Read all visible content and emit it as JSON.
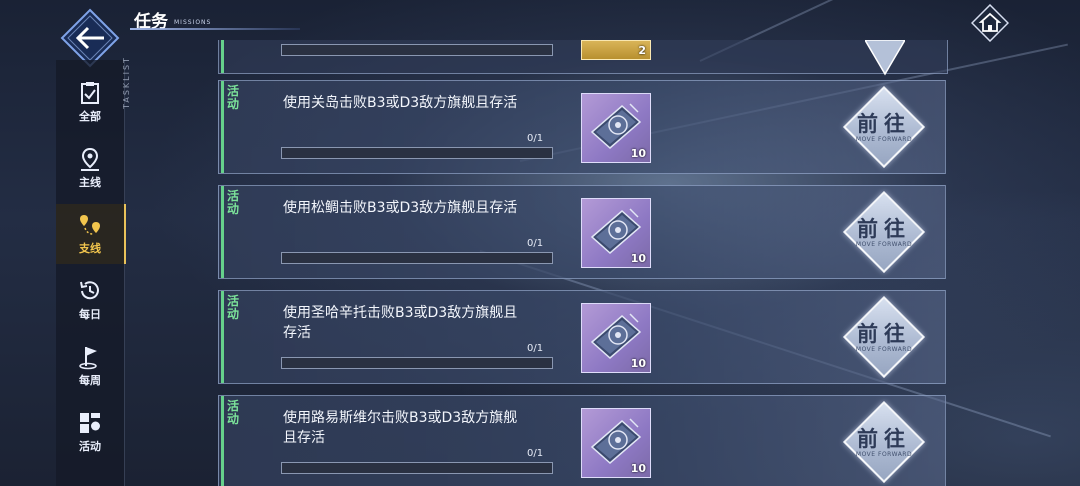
{
  "header": {
    "title": "任务",
    "subtitle": "MISSIONS",
    "side_label": "TASKLIST"
  },
  "sidebar": {
    "items": [
      {
        "label": "全部",
        "icon": "clipboard-check-icon",
        "active": false
      },
      {
        "label": "主线",
        "icon": "map-pin-icon",
        "active": false
      },
      {
        "label": "支线",
        "icon": "branch-pins-icon",
        "active": true
      },
      {
        "label": "每日",
        "icon": "history-clock-icon",
        "active": false
      },
      {
        "label": "每周",
        "icon": "flag-icon",
        "active": false
      },
      {
        "label": "活动",
        "icon": "grid-squares-icon",
        "active": false
      }
    ]
  },
  "top_partial": {
    "reward_qty": "2"
  },
  "tasks": [
    {
      "tag": "活动",
      "desc": "使用关岛击败B3或D3敌方旗舰且存活",
      "progress_text": "0/1",
      "progress": 0,
      "reward_qty": "10",
      "go_label": "前往",
      "go_sub": "MOVE FORWARD"
    },
    {
      "tag": "活动",
      "desc": "使用松鲷击败B3或D3敌方旗舰且存活",
      "progress_text": "0/1",
      "progress": 0,
      "reward_qty": "10",
      "go_label": "前往",
      "go_sub": "MOVE FORWARD"
    },
    {
      "tag": "活动",
      "desc": "使用圣哈辛托击败B3或D3敌方旗舰且存活",
      "progress_text": "0/1",
      "progress": 0,
      "reward_qty": "10",
      "go_label": "前往",
      "go_sub": "MOVE FORWARD"
    },
    {
      "tag": "活动",
      "desc": "使用路易斯维尔击败B3或D3敌方旗舰且存活",
      "progress_text": "0/1",
      "progress": 0,
      "reward_qty": "10",
      "go_label": "前往",
      "go_sub": "MOVE FORWARD"
    }
  ],
  "colors": {
    "accent_green": "#7ce39a",
    "active_gold": "#f2c54d",
    "reward_purple": "#8e79c4"
  }
}
